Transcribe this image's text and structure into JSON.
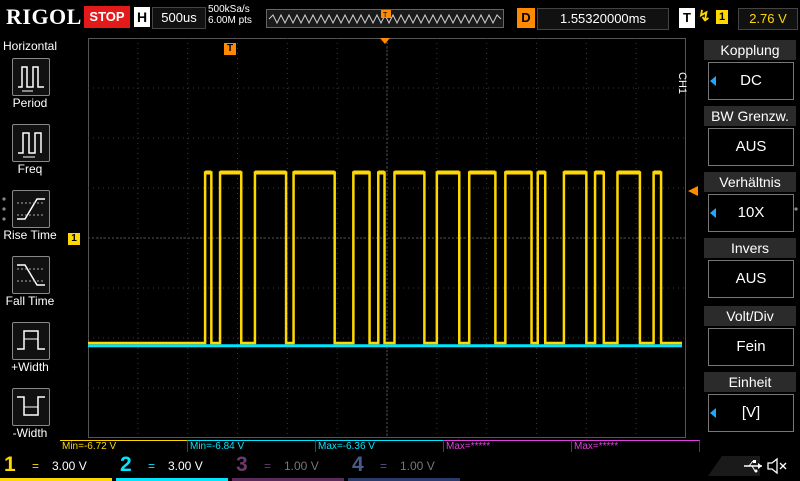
{
  "brand": "RIGOL",
  "status": "STOP",
  "horizontal": {
    "label": "H",
    "timebase": "500us",
    "sample_rate": "500kSa/s",
    "memory_depth": "6.00M pts"
  },
  "delay": {
    "label": "D",
    "value": "1.55320000ms"
  },
  "trigger": {
    "label": "T",
    "slope_symbol": "↯",
    "source": "1",
    "level": "2.76 V"
  },
  "left_menu": {
    "title": "Horizontal",
    "items": [
      {
        "label": "Period",
        "icon": "period-icon"
      },
      {
        "label": "Freq",
        "icon": "freq-icon"
      },
      {
        "label": "Rise Time",
        "icon": "rise-time-icon"
      },
      {
        "label": "Fall Time",
        "icon": "fall-time-icon"
      },
      {
        "label": "+Width",
        "icon": "pos-width-icon"
      },
      {
        "label": "-Width",
        "icon": "neg-width-icon"
      }
    ]
  },
  "right_menu": {
    "channel_tag": "CH1",
    "items": [
      {
        "header": "Kopplung",
        "value": "DC",
        "has_arrow": true
      },
      {
        "header": "BW Grenzw.",
        "value": "AUS",
        "has_arrow": false
      },
      {
        "header": "Verhältnis",
        "value": "10X",
        "has_arrow": true
      },
      {
        "header": "Invers",
        "value": "AUS",
        "has_arrow": false
      },
      {
        "header": "Volt/Div",
        "value": "Fein",
        "has_arrow": false
      },
      {
        "header": "Einheit",
        "value": "[V]",
        "has_arrow": true
      }
    ]
  },
  "markers": {
    "trigger_pos": "T",
    "ch1_ref": "1"
  },
  "measurements": [
    {
      "text": "Min=-6.72 V",
      "color": "#ffd800"
    },
    {
      "text": "Min=-6.84 V",
      "color": "#00e6ff"
    },
    {
      "text": "Max=-6.36 V",
      "color": "#00e6ff"
    },
    {
      "text": "Max=*****",
      "color": "#e040e0"
    },
    {
      "text": "Max=*****",
      "color": "#e040e0"
    }
  ],
  "channels": [
    {
      "num": "1",
      "coupling": "=",
      "scale": "3.00 V",
      "color": "#ffd800",
      "active": true
    },
    {
      "num": "2",
      "coupling": "=",
      "scale": "3.00 V",
      "color": "#00e6ff",
      "active": true
    },
    {
      "num": "3",
      "coupling": "=",
      "scale": "1.00 V",
      "color": "#e040e0",
      "active": false
    },
    {
      "num": "4",
      "coupling": "=",
      "scale": "1.00 V",
      "color": "#1e6cff",
      "active": false
    }
  ],
  "colors": {
    "ch1": "#ffd800",
    "ch2": "#00e6ff",
    "accent": "#1ea7ff",
    "stop": "#e21a1a"
  },
  "chart_data": {
    "type": "line",
    "time_per_div": "500us",
    "volts_per_div": "3.00 V",
    "series": [
      {
        "name": "1",
        "description_level": "digital",
        "pulses": [
          [
            4.7,
            4.95
          ],
          [
            5.3,
            6.15
          ],
          [
            6.7,
            7.95
          ],
          [
            8.25,
            9.9
          ],
          [
            10.65,
            11.3
          ],
          [
            11.65,
            11.9
          ],
          [
            12.3,
            13.5
          ],
          [
            14.0,
            14.9
          ],
          [
            15.3,
            16.35
          ],
          [
            16.75,
            17.8
          ],
          [
            18.05,
            18.35
          ],
          [
            19.1,
            20.0
          ],
          [
            20.35,
            20.7
          ],
          [
            21.25,
            22.15
          ],
          [
            22.7,
            23.0
          ]
        ],
        "high_div": 6.2,
        "low_div": 0.0
      },
      {
        "name": "2",
        "level_div": -0.1
      }
    ]
  }
}
